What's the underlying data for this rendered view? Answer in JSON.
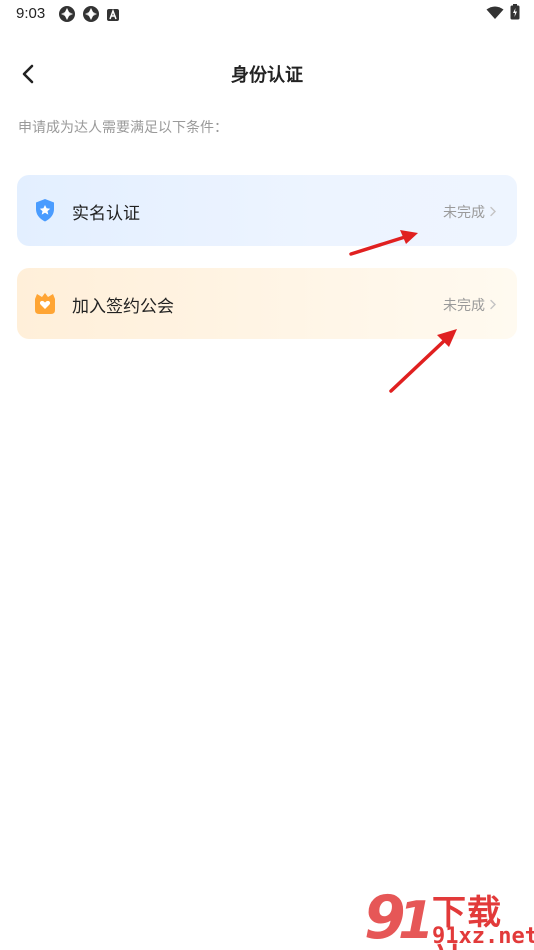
{
  "status_bar": {
    "time": "9:03",
    "left_icons": [
      "sync-icon",
      "sync-icon",
      "app-a-icon"
    ],
    "right_icons": [
      "wifi-icon",
      "battery-icon"
    ]
  },
  "header": {
    "title": "身份认证"
  },
  "hint": "申请成为达人需要满足以下条件：",
  "cards": [
    {
      "label": "实名认证",
      "status": "未完成",
      "icon": "shield-star-icon",
      "accent": "#4a9cff"
    },
    {
      "label": "加入签约公会",
      "status": "未完成",
      "icon": "guild-heart-icon",
      "accent": "#ffa534"
    }
  ],
  "watermark": {
    "line1": "下载站",
    "line2": "91xz.net",
    "logo": "91"
  },
  "colors": {
    "annotation_arrow": "#e02020"
  }
}
